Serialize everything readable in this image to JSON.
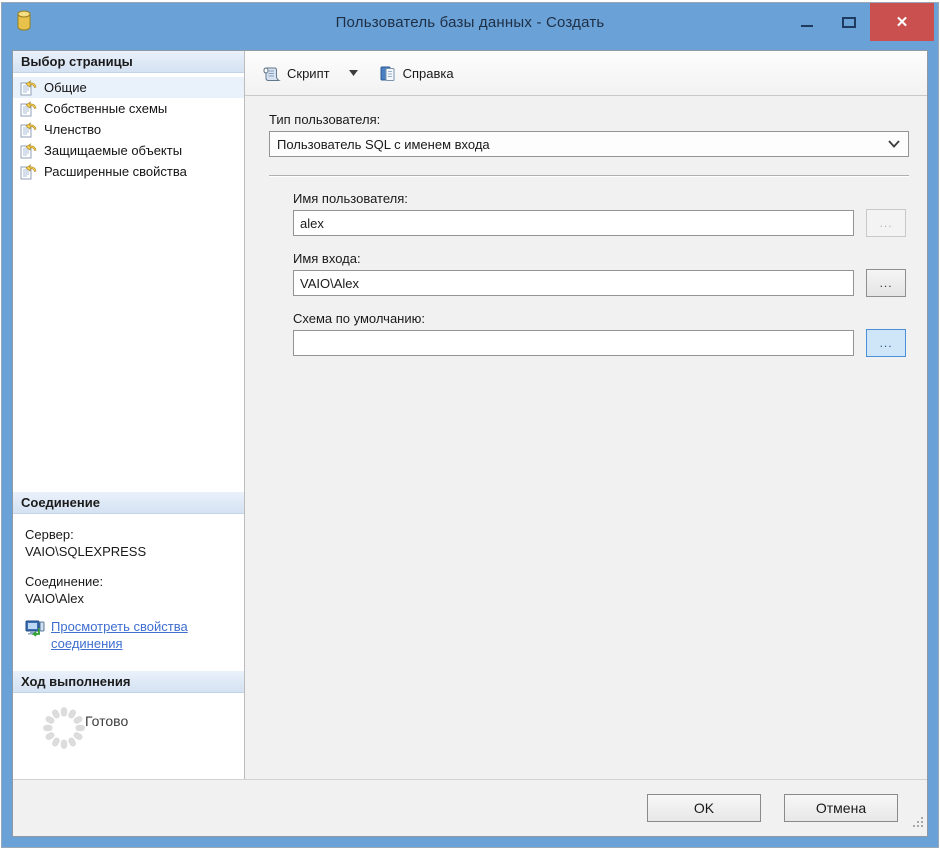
{
  "window": {
    "title": "Пользователь базы данных - Создать",
    "close_glyph": "✕"
  },
  "toolbar": {
    "script_label": "Скрипт",
    "help_label": "Справка"
  },
  "sidebar": {
    "page_selection": {
      "header": "Выбор страницы",
      "items": [
        {
          "label": "Общие"
        },
        {
          "label": "Собственные схемы"
        },
        {
          "label": "Членство"
        },
        {
          "label": "Защищаемые объекты"
        },
        {
          "label": "Расширенные свойства"
        }
      ]
    },
    "connection": {
      "header": "Соединение",
      "server_label": "Сервер:",
      "server_value": "VAIO\\SQLEXPRESS",
      "connection_label": "Соединение:",
      "connection_value": "VAIO\\Alex",
      "link_label": "Просмотреть свойства соединения"
    },
    "progress": {
      "header": "Ход выполнения",
      "status": "Готово"
    }
  },
  "form": {
    "user_type_label": "Тип пользователя:",
    "user_type_value": "Пользователь SQL с именем входа",
    "user_name_label": "Имя пользователя:",
    "user_name_value": "alex",
    "login_name_label": "Имя входа:",
    "login_name_value": "VAIO\\Alex",
    "default_schema_label": "Схема по умолчанию:",
    "default_schema_value": "",
    "browse_label": "..."
  },
  "footer": {
    "ok_label": "OK",
    "cancel_label": "Отмена"
  }
}
